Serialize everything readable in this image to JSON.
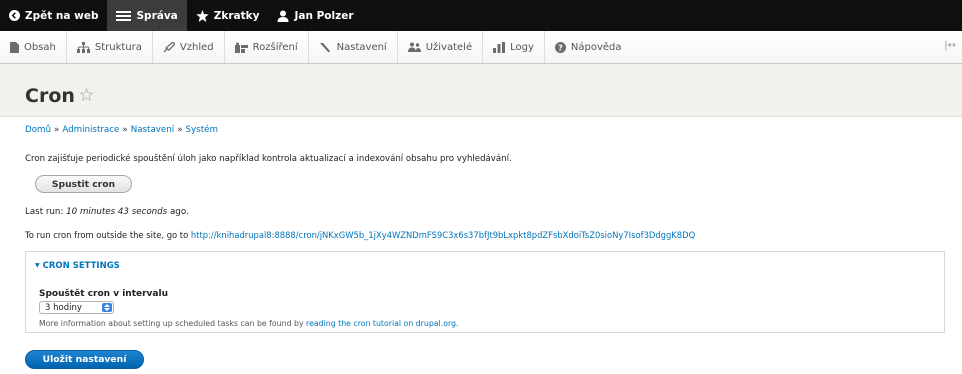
{
  "toolbar": {
    "back_label": "Zpět na web",
    "manage_label": "Správa",
    "shortcuts_label": "Zkratky",
    "user_label": "Jan Polzer"
  },
  "tray": {
    "items": [
      {
        "label": "Obsah",
        "icon": "file-icon"
      },
      {
        "label": "Struktura",
        "icon": "sitemap-icon"
      },
      {
        "label": "Vzhled",
        "icon": "brush-icon"
      },
      {
        "label": "Rozšíření",
        "icon": "puzzle-icon"
      },
      {
        "label": "Nastavení",
        "icon": "wrench-icon"
      },
      {
        "label": "Uživatelé",
        "icon": "people-icon"
      },
      {
        "label": "Logy",
        "icon": "bar-chart-icon"
      },
      {
        "label": "Nápověda",
        "icon": "help-icon"
      }
    ],
    "toggle": "|↔"
  },
  "page": {
    "title": "Cron"
  },
  "breadcrumb": [
    "Domů",
    "Administrace",
    "Nastavení",
    "Systém"
  ],
  "breadcrumb_sep": "»",
  "intro_text": "Cron zajišťuje periodické spouštění úloh jako například kontrola aktualizací a indexování obsahu pro vyhledávání.",
  "run_button": "Spustit cron",
  "last_run": {
    "prefix": "Last run: ",
    "value": "10 minutes 43 seconds",
    "suffix": " ago."
  },
  "outside": {
    "prefix": "To run cron from outside the site, go to ",
    "url": "http://knihadrupal8:8888/cron/jNKxGW5b_1jXy4WZNDmFS9C3x6s37bfJt9bLxpkt8pdZFsbXdoiTsZ0sioNy7Isof3DdggK8DQ"
  },
  "settings": {
    "summary": "CRON SETTINGS",
    "field_label": "Spouštět cron v intervalu",
    "selected": "3 hodiny",
    "desc_prefix": "More information about setting up scheduled tasks can be found by ",
    "desc_link": "reading the cron tutorial on drupal.org",
    "desc_suffix": "."
  },
  "save_button": "Uložit nastavení",
  "colors": {
    "link": "#0074bd",
    "toolbar": "#0f0f0f",
    "primary_button": "#0063b0"
  }
}
